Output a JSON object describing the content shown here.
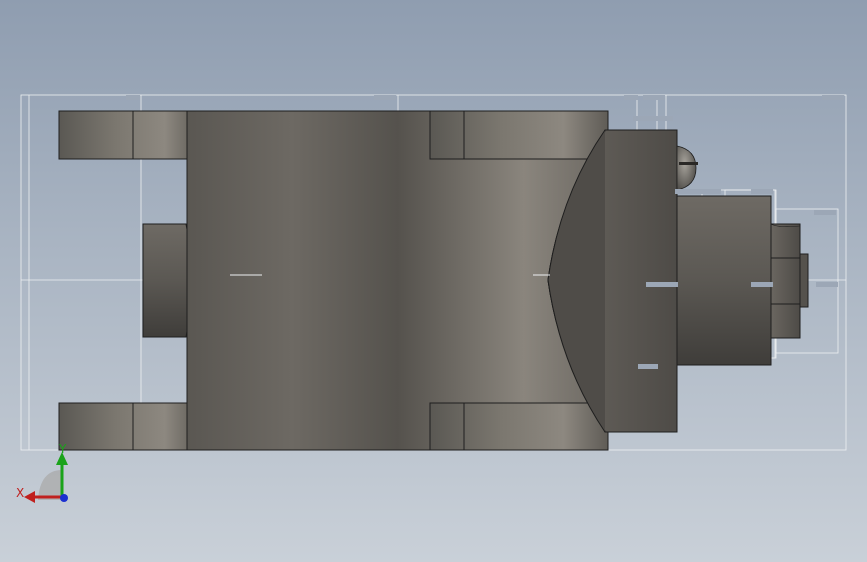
{
  "viewport": {
    "background_top": "#8f9db0",
    "background_bottom": "#c9d0d8"
  },
  "part": {
    "body_color": "#5f5c57",
    "highlight_color": "#8a857d",
    "edge_color": "#1e1e1e",
    "bbox_color": "#f2f2f2"
  },
  "triad": {
    "x_label": "X",
    "y_label": "Y",
    "x_color": "#c0201e",
    "y_color": "#1aa31a",
    "z_color": "#1b2fd0"
  }
}
